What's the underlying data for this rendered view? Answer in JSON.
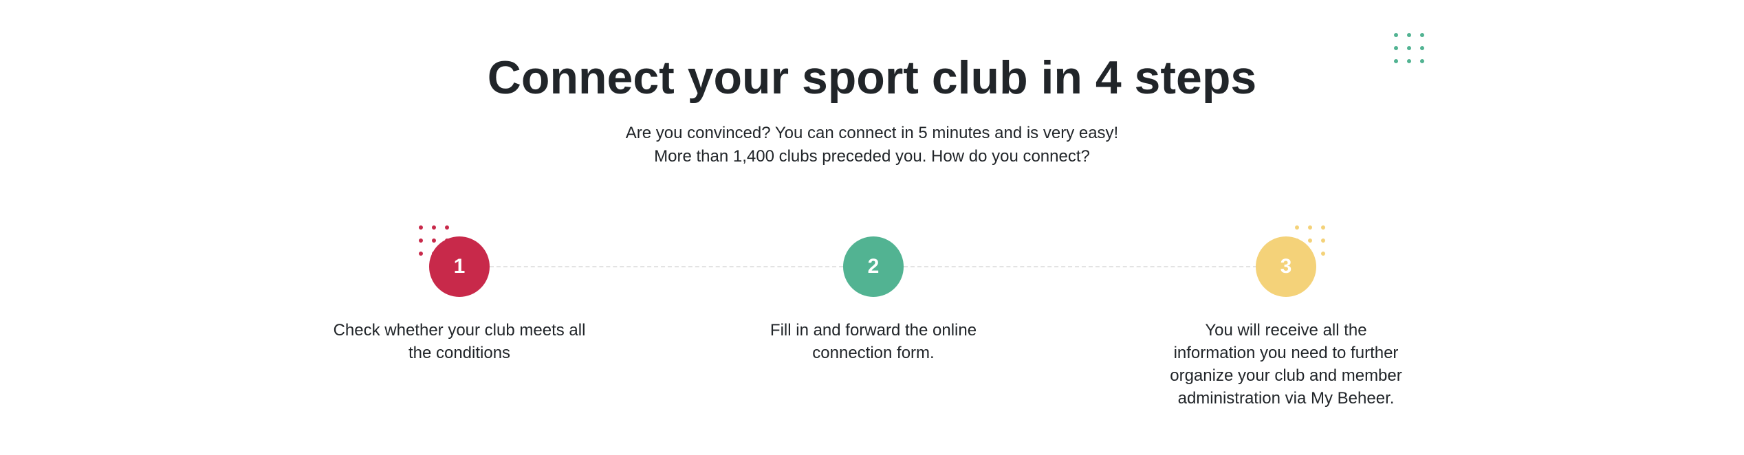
{
  "title": "Connect your sport club in 4 steps",
  "subtitle": {
    "line1": "Are you convinced? You can connect in 5 minutes and is very easy!",
    "line2": "More than 1,400 clubs preceded you. How do you connect?"
  },
  "steps": [
    {
      "number": "1",
      "text": "Check whether your club meets all the conditions",
      "color": "#c8294a"
    },
    {
      "number": "2",
      "text": "Fill in and forward the online connection form.",
      "color": "#52b392"
    },
    {
      "number": "3",
      "text": "You will receive all the information you need to further organize your club and member administration via My Beheer.",
      "color": "#f4d279"
    }
  ],
  "colors": {
    "red": "#c8294a",
    "green": "#52b392",
    "yellow": "#f4d279",
    "text": "#212529",
    "connector": "#e3e3e3"
  }
}
